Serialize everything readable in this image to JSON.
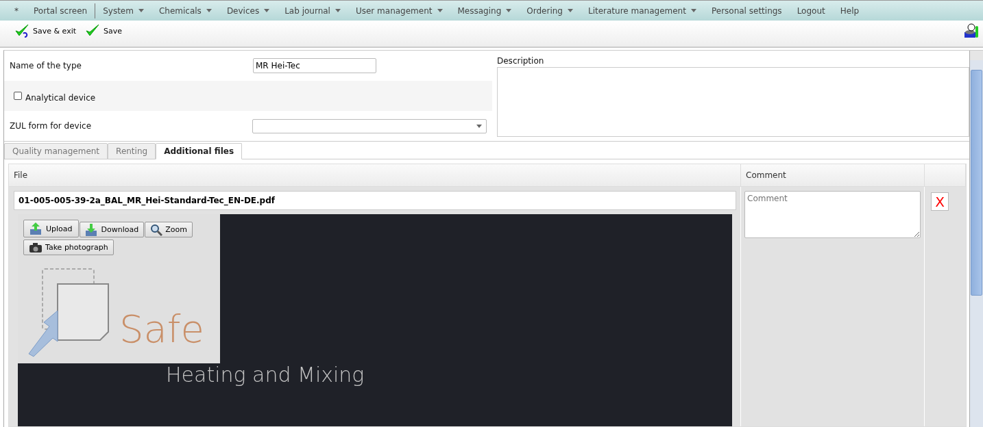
{
  "menu": [
    {
      "kind": "link",
      "label": "*",
      "dropdown": false
    },
    {
      "kind": "link",
      "label": "Portal screen",
      "dropdown": false
    },
    {
      "kind": "separator"
    },
    {
      "kind": "link",
      "label": "System",
      "dropdown": true
    },
    {
      "kind": "link",
      "label": "Chemicals",
      "dropdown": true
    },
    {
      "kind": "link",
      "label": "Devices",
      "dropdown": true
    },
    {
      "kind": "link",
      "label": "Lab journal",
      "dropdown": true
    },
    {
      "kind": "link",
      "label": "User management",
      "dropdown": true
    },
    {
      "kind": "link",
      "label": "Messaging",
      "dropdown": true
    },
    {
      "kind": "link",
      "label": "Ordering",
      "dropdown": true
    },
    {
      "kind": "link",
      "label": "Literature management",
      "dropdown": true
    },
    {
      "kind": "link",
      "label": "Personal settings",
      "dropdown": false
    },
    {
      "kind": "link",
      "label": "Logout",
      "dropdown": false
    },
    {
      "kind": "link",
      "label": "Help",
      "dropdown": false
    }
  ],
  "toolbar": [
    {
      "kind": "save-exit",
      "label": "Save & exit"
    },
    {
      "kind": "save",
      "label": "Save"
    }
  ],
  "form": {
    "name_label": "Name of the type",
    "name_value": "MR Hei-Tec",
    "analytical": {
      "label": "Analytical device",
      "checked": false
    },
    "zul_label": "ZUL form for device",
    "description_label": "Description"
  },
  "tabs": [
    {
      "label": "Quality management",
      "selected": false
    },
    {
      "label": "Renting",
      "selected": false
    },
    {
      "label": "Additional files",
      "selected": true
    }
  ],
  "table": {
    "columns": [
      "File",
      "Comment"
    ],
    "rows": [
      {
        "filename": "01-005-005-39-2a_BAL_MR_Hei-Standard-Tec_EN-DE.pdf",
        "buttons": [
          {
            "kind": "upload",
            "label": "Upload",
            "pressed": true
          },
          {
            "kind": "download",
            "label": "Download",
            "pressed": false
          },
          {
            "kind": "zoom",
            "label": "Zoom",
            "pressed": false
          },
          {
            "kind": "camera",
            "label": "Take photograph",
            "pressed": false
          }
        ],
        "preview_texts": [
          "Safe",
          "Heating and Mixing"
        ],
        "comment_placeholder": "Comment",
        "delete": "X"
      }
    ]
  }
}
